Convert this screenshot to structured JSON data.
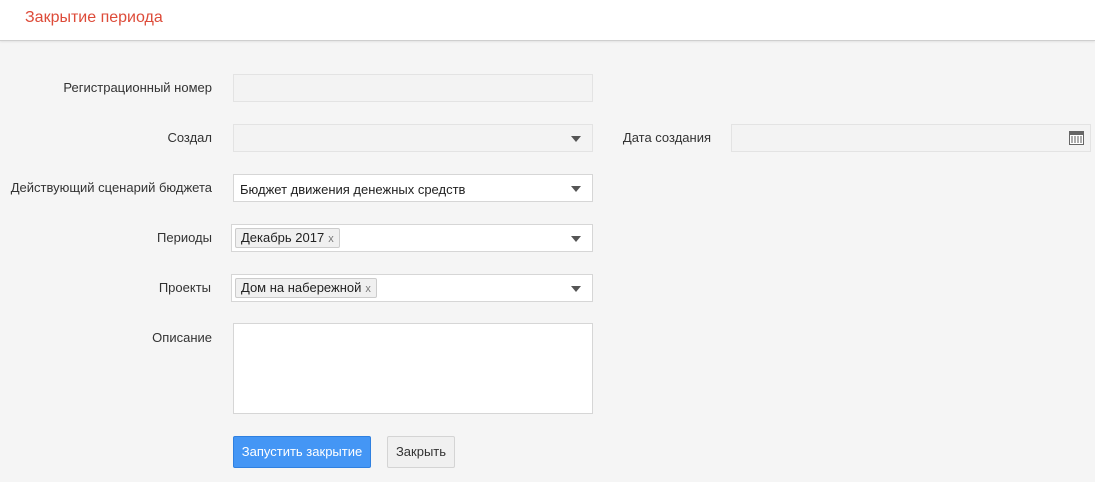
{
  "header": {
    "title": "Закрытие периода"
  },
  "form": {
    "reg_number": {
      "label": "Регистрационный номер",
      "value": ""
    },
    "created_by": {
      "label": "Создал",
      "value": ""
    },
    "created_date": {
      "label": "Дата создания",
      "value": ""
    },
    "budget_scenario": {
      "label": "Действующий сценарий бюджета",
      "value": "Бюджет движения денежных средств"
    },
    "periods": {
      "label": "Периоды",
      "tags": [
        "Декабрь 2017"
      ]
    },
    "projects": {
      "label": "Проекты",
      "tags": [
        "Дом на набережной"
      ]
    },
    "description": {
      "label": "Описание",
      "value": ""
    },
    "tag_remove": "x"
  },
  "buttons": {
    "run_closing": "Запустить закрытие",
    "close": "Закрыть"
  },
  "colors": {
    "title": "#dd4b39",
    "primary_button": "#4496f5",
    "background": "#f5f5f5"
  },
  "icons": {
    "dropdown": "chevron-down-icon",
    "date": "calendar-icon",
    "tag_remove": "close-icon"
  }
}
